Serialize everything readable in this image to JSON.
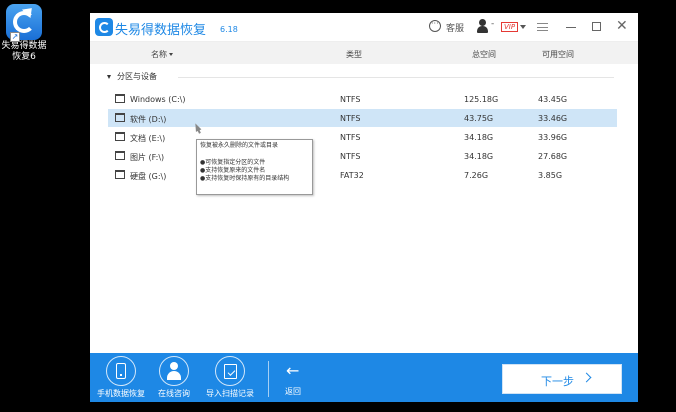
{
  "desktop": {
    "shortcut_label": "失易得数据恢复6"
  },
  "titlebar": {
    "app_name": "失易得数据恢复",
    "version": "6.18",
    "service_label": "客服",
    "user_text": "-",
    "vip_label": "VIP"
  },
  "table": {
    "headers": {
      "name": "名称",
      "type": "类型",
      "total": "总空间",
      "free": "可用空间"
    },
    "group_label": "分区与设备",
    "rows": [
      {
        "name": "Windows (C:\\)",
        "type": "NTFS",
        "total": "125.18G",
        "free": "43.45G",
        "selected": false
      },
      {
        "name": "软件 (D:\\)",
        "type": "NTFS",
        "total": "43.75G",
        "free": "33.46G",
        "selected": true
      },
      {
        "name": "文档 (E:\\)",
        "type": "NTFS",
        "total": "34.18G",
        "free": "33.96G",
        "selected": false
      },
      {
        "name": "图片 (F:\\)",
        "type": "NTFS",
        "total": "34.18G",
        "free": "27.68G",
        "selected": false
      },
      {
        "name": "硬盘 (G:\\)",
        "type": "FAT32",
        "total": "7.26G",
        "free": "3.85G",
        "selected": false
      }
    ]
  },
  "tooltip": {
    "title": "恢复被永久删除的文件或目录",
    "points": [
      "●可恢复指定分区的文件",
      "●支持恢复原来的文件名",
      "●支持恢复时保持原有的目录结构"
    ]
  },
  "bottom": {
    "buttons": [
      {
        "label": "手机数据恢复",
        "icon": "phone-icon"
      },
      {
        "label": "在线咨询",
        "icon": "user-icon"
      },
      {
        "label": "导入扫描记录",
        "icon": "import-icon"
      }
    ],
    "back_label": "返回",
    "next_label": "下一步"
  },
  "colors": {
    "accent": "#1e88e5",
    "selected_row": "#cfe5f7",
    "vip": "#e53935"
  }
}
